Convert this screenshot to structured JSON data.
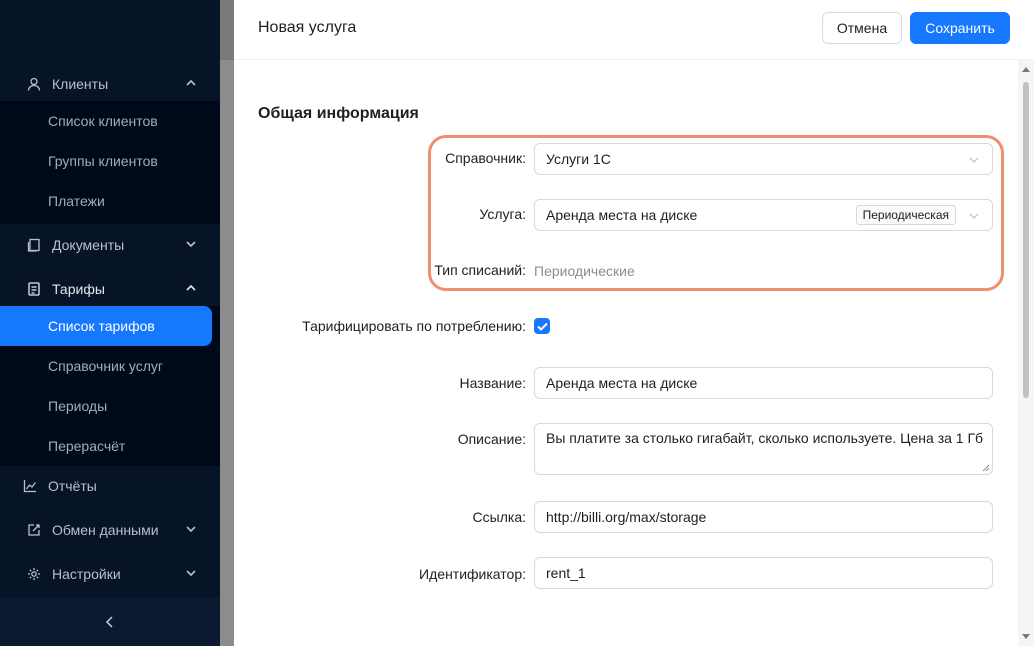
{
  "sidebar": {
    "groups": [
      {
        "label": "Клиенты",
        "icon": "user-icon",
        "expanded": true,
        "items": [
          "Список клиентов",
          "Группы клиентов",
          "Платежи"
        ]
      },
      {
        "label": "Документы",
        "icon": "documents-icon",
        "expanded": false
      },
      {
        "label": "Тарифы",
        "icon": "tariffs-icon",
        "expanded": true,
        "items": [
          "Список тарифов",
          "Справочник услуг",
          "Периоды",
          "Перерасчёт"
        ]
      },
      {
        "label": "Отчёты",
        "icon": "chart-icon"
      },
      {
        "label": "Обмен данными",
        "icon": "exchange-icon",
        "expanded": false
      },
      {
        "label": "Настройки",
        "icon": "settings-icon",
        "expanded": false
      }
    ],
    "active_item": "Список тарифов",
    "collapse_icon": "chevron-left-icon"
  },
  "drawer": {
    "title": "Новая услуга",
    "cancel_label": "Отмена",
    "save_label": "Сохранить"
  },
  "form": {
    "section_title": "Общая информация",
    "directory": {
      "label": "Справочник:",
      "value": "Услуги 1С"
    },
    "service": {
      "label": "Услуга:",
      "value": "Аренда места на диске",
      "tag": "Периодическая"
    },
    "charge_type": {
      "label": "Тип списаний:",
      "value": "Периодические"
    },
    "usage_billing": {
      "label": "Тарифицировать по потреблению:",
      "checked": true
    },
    "name": {
      "label": "Название:",
      "value": "Аренда места на диске"
    },
    "description": {
      "label": "Описание:",
      "value": "Вы платите за столько гигабайт, сколько используете. Цена за 1 Гб"
    },
    "link": {
      "label": "Ссылка:",
      "value": "http://billi.org/max/storage"
    },
    "identifier": {
      "label": "Идентификатор:",
      "value": "rent_1"
    }
  },
  "colors": {
    "sidebar_bg": "#071427",
    "accent": "#1677ff",
    "highlight": "#ef8f6f"
  }
}
